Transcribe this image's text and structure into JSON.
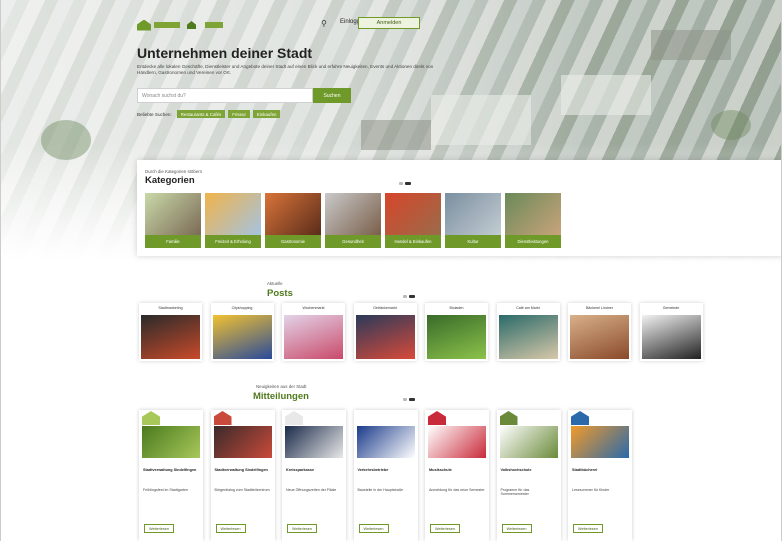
{
  "header": {
    "register_label": "Anmelden",
    "login_label": "Einloggen"
  },
  "hero": {
    "title": "Unternehmen deiner Stadt",
    "intro": "Entdecke alle lokalen Geschäfte, Dienstleister und Angebote deiner Stadt auf einen Blick und erfahre Neuigkeiten, Events und Aktionen direkt von Händlern, Gastronomen und Vereinen vor Ort.",
    "search_placeholder": "Wonach suchst du?",
    "search_button": "Suchen",
    "quick_label": "Beliebte Suchen:",
    "chips": [
      "Restaurants & Cafés",
      "Friseur",
      "Einkaufen"
    ]
  },
  "categories": {
    "kicker": "Durch die Kategorien stöbern",
    "title": "Kategorien",
    "items": [
      {
        "label": "Familie",
        "colors": [
          "#c9d9a8",
          "#7b6a55"
        ]
      },
      {
        "label": "Freizeit & Erholung",
        "colors": [
          "#f0b34a",
          "#a4c3e0"
        ]
      },
      {
        "label": "Gastronomie",
        "colors": [
          "#d9743a",
          "#5a2c1a"
        ]
      },
      {
        "label": "Gesundheit",
        "colors": [
          "#c9c9c9",
          "#7a5f4a"
        ]
      },
      {
        "label": "Handel & Einkaufen",
        "colors": [
          "#d7452a",
          "#9a6b4a"
        ]
      },
      {
        "label": "Kultur",
        "colors": [
          "#7a8fa0",
          "#c3ccd2"
        ]
      },
      {
        "label": "Dienstleistungen",
        "colors": [
          "#6a8a5a",
          "#c9a37a"
        ]
      }
    ]
  },
  "posts": {
    "kicker": "Aktuelle",
    "title": "Posts",
    "items": [
      {
        "title": "Stadtmarketing",
        "colors": [
          "#2a2a2a",
          "#c94a2a"
        ]
      },
      {
        "title": "Cityshopping",
        "colors": [
          "#f2c230",
          "#2a4a9a"
        ]
      },
      {
        "title": "Wochenmarkt",
        "colors": [
          "#e3d3e8",
          "#c94a6a"
        ]
      },
      {
        "title": "Getränkemarkt",
        "colors": [
          "#2a3a5a",
          "#d94a3a"
        ]
      },
      {
        "title": "Bioladen",
        "colors": [
          "#3a6a2a",
          "#8bc34a"
        ]
      },
      {
        "title": "Café am Markt",
        "colors": [
          "#2a6a6a",
          "#d8c8a8"
        ]
      },
      {
        "title": "Bäckerei Lindner",
        "colors": [
          "#d8b08a",
          "#8a4a2a"
        ]
      },
      {
        "title": "Gemeinde",
        "colors": [
          "#f2f2f2",
          "#222222"
        ]
      }
    ]
  },
  "messages": {
    "kicker": "Neuigkeiten aus der Stadt",
    "title": "Mitteilungen",
    "read_more": "Weiterlesen",
    "items": [
      {
        "title": "Stadtverwaltung Sindelfingen",
        "text": "Frühlingsfest im Stadtgarten",
        "colors": [
          "#4a7a1e",
          "#a8c85a"
        ]
      },
      {
        "title": "Stadtverwaltung Sindelfingen",
        "text": "Bürgerdialog zum Stadtteilzentrum",
        "colors": [
          "#3a2a2a",
          "#c94a3a"
        ]
      },
      {
        "title": "Kreissparkasse",
        "text": "Neue Öffnungszeiten der Filiale",
        "colors": [
          "#1a2a4a",
          "#e8e8e8"
        ]
      },
      {
        "title": "Verkehrsbetriebe",
        "text": "Baustelle in der Hauptstraße",
        "colors": [
          "#1a3a8a",
          "#ffffff"
        ]
      },
      {
        "title": "Musikschule",
        "text": "Anmeldung für das neue Semester",
        "colors": [
          "#ffffff",
          "#c92a3a"
        ]
      },
      {
        "title": "Volkshochschule",
        "text": "Programm für das Sommersemester",
        "colors": [
          "#ffffff",
          "#6a8a3a"
        ]
      },
      {
        "title": "Stadtbücherei",
        "text": "Lesesommer für Kinder",
        "colors": [
          "#f29a2a",
          "#2a6aaa"
        ]
      }
    ]
  }
}
